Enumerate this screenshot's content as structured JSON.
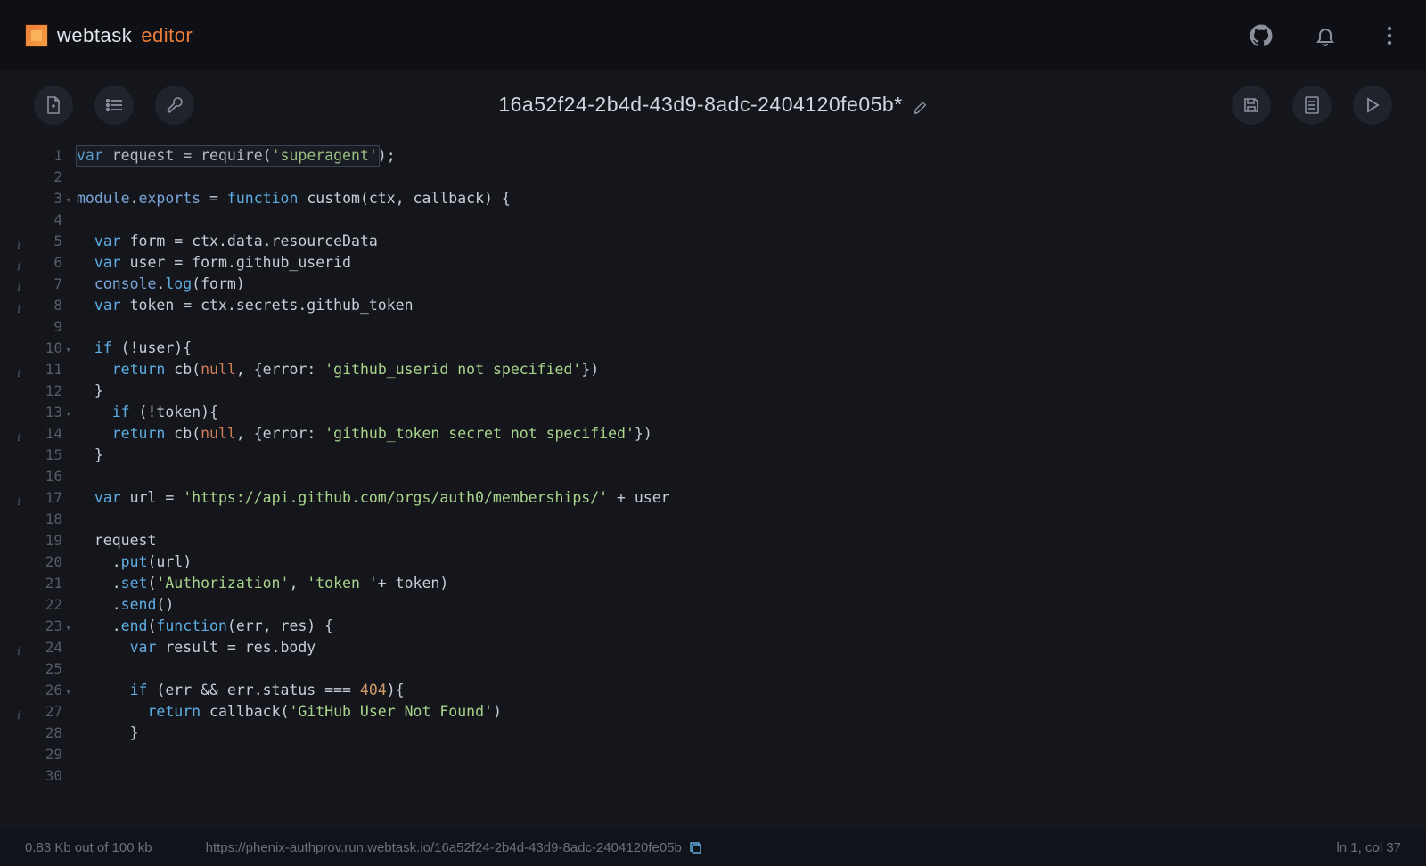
{
  "brand": {
    "word1": "webtask",
    "word2": "editor"
  },
  "filename": "16a52f24-2b4d-43d9-8adc-2404120fe05b*",
  "status": {
    "size": "0.83 Kb out of 100 kb",
    "url": "https://phenix-authprov.run.webtask.io/16a52f24-2b4d-43d9-8adc-2404120fe05b",
    "cursor": "ln 1, col 37"
  },
  "gutter": [
    {
      "n": 1,
      "info": false,
      "fold": false
    },
    {
      "n": 2,
      "info": false,
      "fold": false
    },
    {
      "n": 3,
      "info": false,
      "fold": true
    },
    {
      "n": 4,
      "info": false,
      "fold": false
    },
    {
      "n": 5,
      "info": true,
      "fold": false
    },
    {
      "n": 6,
      "info": true,
      "fold": false
    },
    {
      "n": 7,
      "info": true,
      "fold": false
    },
    {
      "n": 8,
      "info": true,
      "fold": false
    },
    {
      "n": 9,
      "info": false,
      "fold": false
    },
    {
      "n": 10,
      "info": false,
      "fold": true
    },
    {
      "n": 11,
      "info": true,
      "fold": false
    },
    {
      "n": 12,
      "info": false,
      "fold": false
    },
    {
      "n": 13,
      "info": false,
      "fold": true
    },
    {
      "n": 14,
      "info": true,
      "fold": false
    },
    {
      "n": 15,
      "info": false,
      "fold": false
    },
    {
      "n": 16,
      "info": false,
      "fold": false
    },
    {
      "n": 17,
      "info": true,
      "fold": false
    },
    {
      "n": 18,
      "info": false,
      "fold": false
    },
    {
      "n": 19,
      "info": false,
      "fold": false
    },
    {
      "n": 20,
      "info": false,
      "fold": false
    },
    {
      "n": 21,
      "info": false,
      "fold": false
    },
    {
      "n": 22,
      "info": false,
      "fold": false
    },
    {
      "n": 23,
      "info": false,
      "fold": true
    },
    {
      "n": 24,
      "info": true,
      "fold": false
    },
    {
      "n": 25,
      "info": false,
      "fold": false
    },
    {
      "n": 26,
      "info": false,
      "fold": true
    },
    {
      "n": 27,
      "info": true,
      "fold": false
    },
    {
      "n": 28,
      "info": false,
      "fold": false
    },
    {
      "n": 29,
      "info": false,
      "fold": false
    },
    {
      "n": 30,
      "info": false,
      "fold": false
    }
  ],
  "code": [
    [
      [
        "kw",
        "var"
      ],
      [
        "text",
        " request = "
      ],
      [
        "fn",
        "require"
      ],
      [
        "punct",
        "("
      ],
      [
        "str",
        "'superagent'"
      ],
      [
        "punct",
        ");"
      ]
    ],
    [],
    [
      [
        "obj",
        "module"
      ],
      [
        "text",
        "."
      ],
      [
        "obj",
        "exports"
      ],
      [
        "text",
        " = "
      ],
      [
        "kw",
        "function"
      ],
      [
        "text",
        " "
      ],
      [
        "fn",
        "custom"
      ],
      [
        "punct",
        "(ctx, callback) {"
      ]
    ],
    [],
    [
      [
        "text",
        "  "
      ],
      [
        "kw",
        "var"
      ],
      [
        "text",
        " form = ctx.data.resourceData"
      ]
    ],
    [
      [
        "text",
        "  "
      ],
      [
        "kw",
        "var"
      ],
      [
        "text",
        " user = form.github_userid"
      ]
    ],
    [
      [
        "text",
        "  "
      ],
      [
        "console",
        "console"
      ],
      [
        "text",
        "."
      ],
      [
        "method",
        "log"
      ],
      [
        "punct",
        "("
      ],
      [
        "text",
        "form"
      ],
      [
        "punct",
        ")"
      ]
    ],
    [
      [
        "text",
        "  "
      ],
      [
        "kw",
        "var"
      ],
      [
        "text",
        " token = ctx.secrets.github_token"
      ]
    ],
    [],
    [
      [
        "text",
        "  "
      ],
      [
        "kw",
        "if"
      ],
      [
        "text",
        " (!user){"
      ]
    ],
    [
      [
        "text",
        "    "
      ],
      [
        "kw",
        "return"
      ],
      [
        "text",
        " "
      ],
      [
        "fn",
        "cb"
      ],
      [
        "punct",
        "("
      ],
      [
        "null",
        "null"
      ],
      [
        "punct",
        ", {"
      ],
      [
        "text",
        "error: "
      ],
      [
        "str",
        "'github_userid not specified'"
      ],
      [
        "punct",
        "})"
      ]
    ],
    [
      [
        "text",
        "  }"
      ]
    ],
    [
      [
        "text",
        "    "
      ],
      [
        "kw",
        "if"
      ],
      [
        "text",
        " (!token){"
      ]
    ],
    [
      [
        "text",
        "    "
      ],
      [
        "kw",
        "return"
      ],
      [
        "text",
        " "
      ],
      [
        "fn",
        "cb"
      ],
      [
        "punct",
        "("
      ],
      [
        "null",
        "null"
      ],
      [
        "punct",
        ", {"
      ],
      [
        "text",
        "error: "
      ],
      [
        "str",
        "'github_token secret not specified'"
      ],
      [
        "punct",
        "})"
      ]
    ],
    [
      [
        "text",
        "  }"
      ]
    ],
    [],
    [
      [
        "text",
        "  "
      ],
      [
        "kw",
        "var"
      ],
      [
        "text",
        " url = "
      ],
      [
        "str",
        "'https://api.github.com/orgs/auth0/memberships/'"
      ],
      [
        "text",
        " + user"
      ]
    ],
    [],
    [
      [
        "text",
        "  request"
      ]
    ],
    [
      [
        "text",
        "    ."
      ],
      [
        "method",
        "put"
      ],
      [
        "punct",
        "("
      ],
      [
        "text",
        "url"
      ],
      [
        "punct",
        ")"
      ]
    ],
    [
      [
        "text",
        "    ."
      ],
      [
        "method",
        "set"
      ],
      [
        "punct",
        "("
      ],
      [
        "str",
        "'Authorization'"
      ],
      [
        "punct",
        ", "
      ],
      [
        "str",
        "'token '"
      ],
      [
        "text",
        "+ token"
      ],
      [
        "punct",
        ")"
      ]
    ],
    [
      [
        "text",
        "    ."
      ],
      [
        "method",
        "send"
      ],
      [
        "punct",
        "()"
      ]
    ],
    [
      [
        "text",
        "    ."
      ],
      [
        "method",
        "end"
      ],
      [
        "punct",
        "("
      ],
      [
        "kw",
        "function"
      ],
      [
        "punct",
        "(err, res) {"
      ]
    ],
    [
      [
        "text",
        "      "
      ],
      [
        "kw",
        "var"
      ],
      [
        "text",
        " result = res.body"
      ]
    ],
    [],
    [
      [
        "text",
        "      "
      ],
      [
        "kw",
        "if"
      ],
      [
        "text",
        " (err && err.status === "
      ],
      [
        "num",
        "404"
      ],
      [
        "punct",
        "){"
      ]
    ],
    [
      [
        "text",
        "        "
      ],
      [
        "kw",
        "return"
      ],
      [
        "text",
        " "
      ],
      [
        "fn",
        "callback"
      ],
      [
        "punct",
        "("
      ],
      [
        "str",
        "'GitHub User Not Found'"
      ],
      [
        "punct",
        ")"
      ]
    ],
    [
      [
        "text",
        "      }"
      ]
    ],
    [],
    []
  ]
}
